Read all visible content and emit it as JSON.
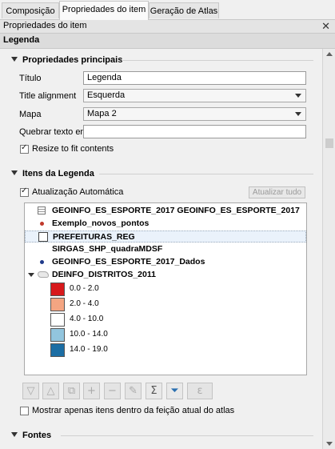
{
  "tabs": [
    {
      "label": "Composição",
      "active": false
    },
    {
      "label": "Propriedades do item",
      "active": true
    },
    {
      "label": "Geração de Atlas",
      "active": false
    }
  ],
  "panel": {
    "title": "Propriedades do item",
    "close": "✕"
  },
  "section": {
    "title": "Legenda"
  },
  "main_props": {
    "heading": "Propriedades principais",
    "title_label": "Título",
    "title_value": "Legenda",
    "align_label": "Title alignment",
    "align_value": "Esquerda",
    "map_label": "Mapa",
    "map_value": "Mapa 2",
    "wrap_label": "Quebrar texto em",
    "wrap_value": "",
    "resize_label": "Resize to fit contents",
    "resize_checked": true
  },
  "legend_items": {
    "heading": "Itens da Legenda",
    "auto_update_label": "Atualização Automática",
    "auto_update_checked": true,
    "update_all_button": "Atualizar tudo",
    "tree": [
      {
        "label": "GEOINFO_ES_ESPORTE_2017 GEOINFO_ES_ESPORTE_2017",
        "icon": "table-icon"
      },
      {
        "label": "Exemplo_novos_pontos",
        "icon": "point-icon",
        "color": "#c0392b"
      },
      {
        "label": "PREFEITURAS_REG",
        "icon": "polygon-icon",
        "selected": true
      },
      {
        "label": "SIRGAS_SHP_quadraMDSF",
        "icon": "none"
      },
      {
        "label": "GEOINFO_ES_ESPORTE_2017_Dados",
        "icon": "point-icon",
        "color": "#1f3a8a"
      },
      {
        "label": "DEINFO_DISTRITOS_2011",
        "icon": "polygon-group-icon",
        "expanded": true
      }
    ],
    "classes": [
      {
        "label": "0.0 - 2.0",
        "color": "#d7191c"
      },
      {
        "label": "2.0 - 4.0",
        "color": "#f4a582"
      },
      {
        "label": "4.0 - 10.0",
        "color": "#ffffff"
      },
      {
        "label": "10.0 - 14.0",
        "color": "#92c5de"
      },
      {
        "label": "14.0 - 19.0",
        "color": "#1c6ea4"
      }
    ],
    "only_inside_label": "Mostrar apenas itens dentro da feição atual do atlas",
    "only_inside_checked": false
  },
  "fonts": {
    "heading": "Fontes"
  },
  "toolbar": {
    "buttons": [
      {
        "name": "move-down-button",
        "glyph": "▽"
      },
      {
        "name": "move-up-button",
        "glyph": "△"
      },
      {
        "name": "add-group-button",
        "glyph": "⧉"
      },
      {
        "name": "add-item-button",
        "glyph": "+"
      },
      {
        "name": "remove-item-button",
        "glyph": "−"
      },
      {
        "name": "edit-item-button",
        "glyph": "✎"
      },
      {
        "name": "count-button",
        "glyph": "Σ"
      },
      {
        "name": "filter-button",
        "glyph": "⏷"
      },
      {
        "name": "expression-button",
        "glyph": "ε"
      }
    ]
  }
}
